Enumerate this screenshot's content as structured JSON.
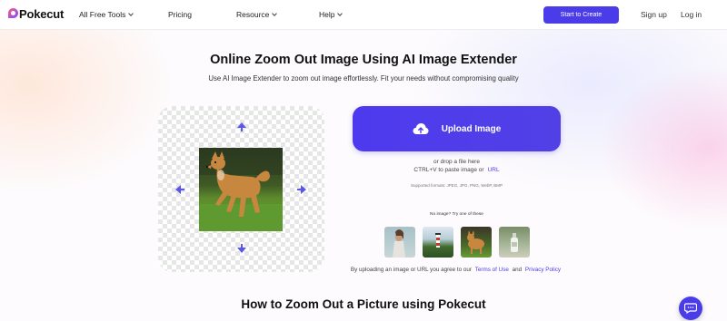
{
  "nav": {
    "logo_text": "Pokecut",
    "items": [
      {
        "label": "All Free Tools"
      },
      {
        "label": "Pricing"
      },
      {
        "label": "Resource"
      },
      {
        "label": "Help"
      }
    ],
    "cta_label": "Start to Create",
    "signup_label": "Sign up",
    "login_label": "Log in"
  },
  "hero": {
    "title": "Online Zoom Out Image Using AI Image Extender",
    "subtitle": "Use AI Image Extender to zoom out image effortlessly. Fit your needs without compromising quality"
  },
  "upload": {
    "button_label": "Upload Image",
    "drop_text": "or drop a file here",
    "paste_text": "CTRL+V to paste image or",
    "url_label": "URL",
    "formats_text": "Supported formats: JPEG, JPG, PNG, WebP, BMP"
  },
  "samples": {
    "prompt": "No image? Try one of these"
  },
  "terms": {
    "prefix": "By uploading an image or URL you agree to our",
    "terms_label": "Terms of Use",
    "and": "and",
    "privacy_label": "Privacy Policy"
  },
  "section": {
    "howto_title": "How to Zoom Out a Picture using Pokecut"
  },
  "colors": {
    "accent": "#4a3ce8"
  }
}
